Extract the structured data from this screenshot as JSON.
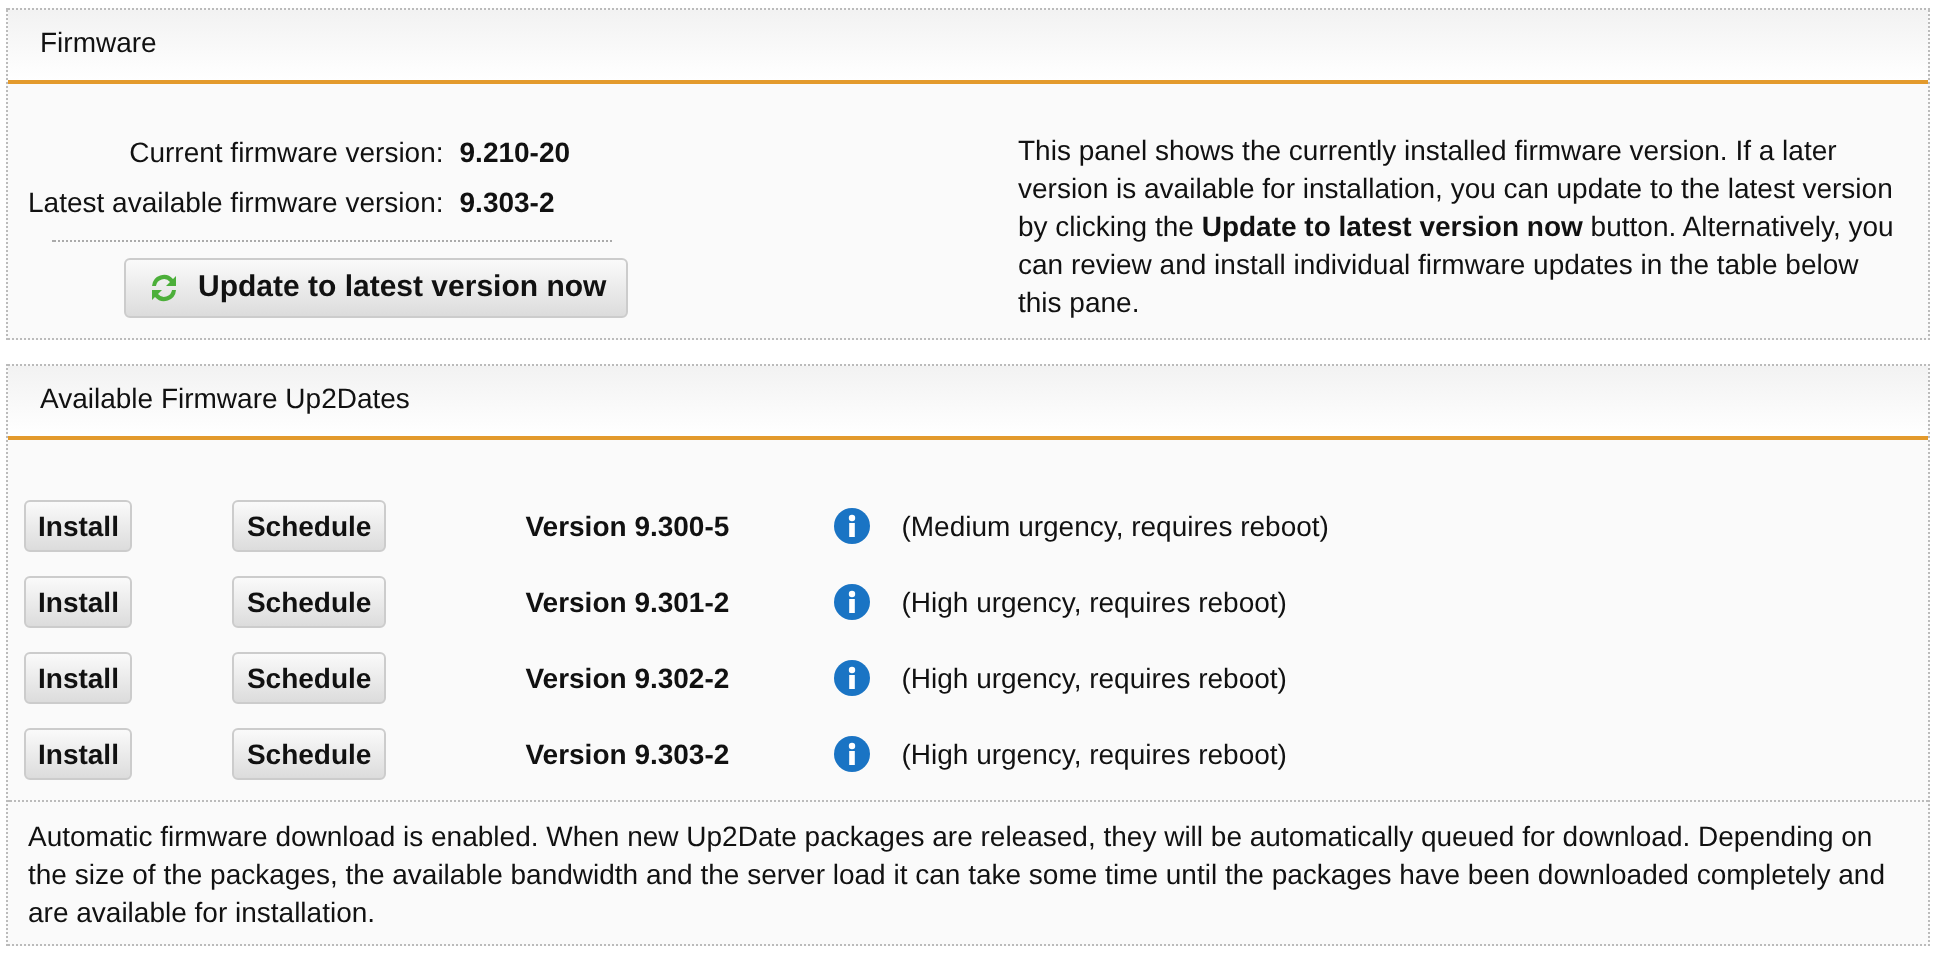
{
  "firmware_panel": {
    "title": "Firmware",
    "info": [
      {
        "label": "Current firmware version:",
        "value": "9.210-20"
      },
      {
        "label": "Latest available firmware version:",
        "value": "9.303-2"
      }
    ],
    "update_button": "Update to latest version now",
    "description": "This panel shows the currently installed firmware version. If a later version is available for installation, you can update to the latest version by clicking the **Update to latest version now** button. Alternatively, you can review and install individual firmware updates in the table below this pane."
  },
  "updates_panel": {
    "title": "Available Firmware Up2Dates",
    "rows": [
      {
        "install": "Install",
        "schedule": "Schedule",
        "version": "Version 9.300-5",
        "note": "(Medium urgency, requires reboot)"
      },
      {
        "install": "Install",
        "schedule": "Schedule",
        "version": "Version 9.301-2",
        "note": "(High urgency, requires reboot)"
      },
      {
        "install": "Install",
        "schedule": "Schedule",
        "version": "Version 9.302-2",
        "note": "(High urgency, requires reboot)"
      },
      {
        "install": "Install",
        "schedule": "Schedule",
        "version": "Version 9.303-2",
        "note": "(High urgency, requires reboot)"
      }
    ],
    "footer": "Automatic firmware download is enabled. When new Up2Date packages are released, they will be automatically queued for download. Depending on the size of the packages, the available bandwidth and the server load it can take some time until the packages have been downloaded completely and are available for installation."
  }
}
